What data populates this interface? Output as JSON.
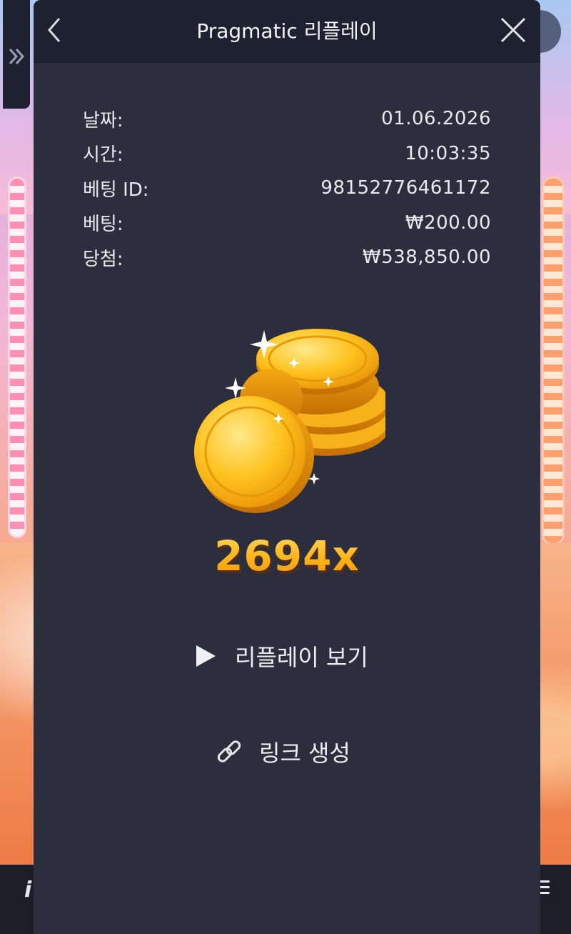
{
  "header": {
    "title": "Pragmatic 리플레이"
  },
  "details": [
    {
      "label": "날짜:",
      "value": "01.06.2026"
    },
    {
      "label": "시간:",
      "value": "10:03:35"
    },
    {
      "label": "베팅 ID:",
      "value": "98152776461172"
    },
    {
      "label": "베팅:",
      "value": "₩200.00"
    },
    {
      "label": "당첨:",
      "value": "₩538,850.00"
    }
  ],
  "result": {
    "multiplier": "2694x"
  },
  "actions": {
    "watch_replay": "리플레이 보기",
    "create_link": "링크 생성"
  },
  "colors": {
    "panel_bg": "#2c2e3d",
    "header_bg": "#1e2130",
    "accent_gold": "#ffb318"
  },
  "icons": {
    "side_toggle": "double-chevron-right-icon",
    "back": "chevron-left-icon",
    "close": "close-icon",
    "replay": "play-icon",
    "link": "link-icon",
    "coins": "gold-coins-icon"
  }
}
